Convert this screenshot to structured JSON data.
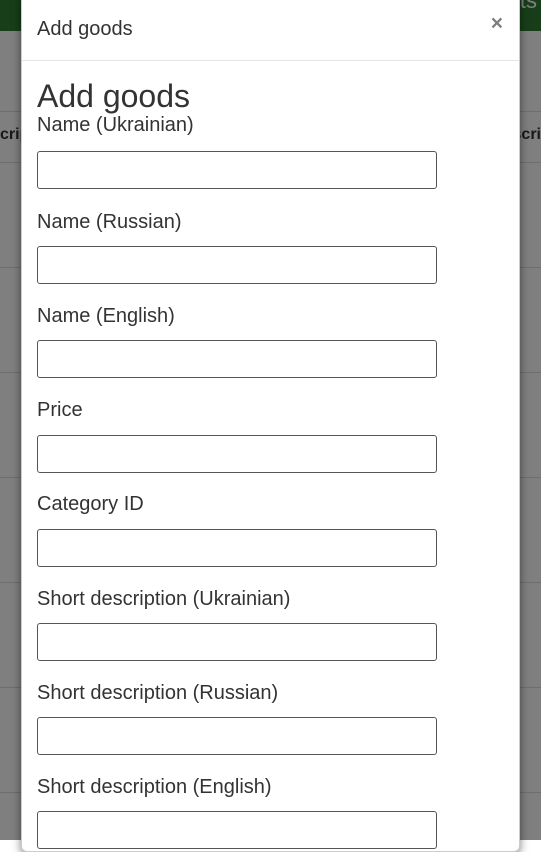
{
  "background": {
    "topbar_text": "ts",
    "col_left_header": "crip",
    "col_right_header": "scri"
  },
  "modal": {
    "title": "Add goods",
    "close_label": "×",
    "heading": "Add goods",
    "fields": [
      {
        "label": "Name (Ukrainian)",
        "value": "",
        "placeholder": ""
      },
      {
        "label": "Name (Russian)",
        "value": "",
        "placeholder": ""
      },
      {
        "label": "Name (English)",
        "value": "",
        "placeholder": ""
      },
      {
        "label": "Price",
        "value": "",
        "placeholder": ""
      },
      {
        "label": "Category ID",
        "value": "",
        "placeholder": ""
      },
      {
        "label": "Short description (Ukrainian)",
        "value": "",
        "placeholder": ""
      },
      {
        "label": "Short description (Russian)",
        "value": "",
        "placeholder": ""
      },
      {
        "label": "Short description (English)",
        "value": "",
        "placeholder": ""
      }
    ]
  },
  "colors": {
    "topbar": "#2e7d32",
    "backdrop": "rgba(0,0,0,0.5)",
    "input_border": "#555555"
  }
}
